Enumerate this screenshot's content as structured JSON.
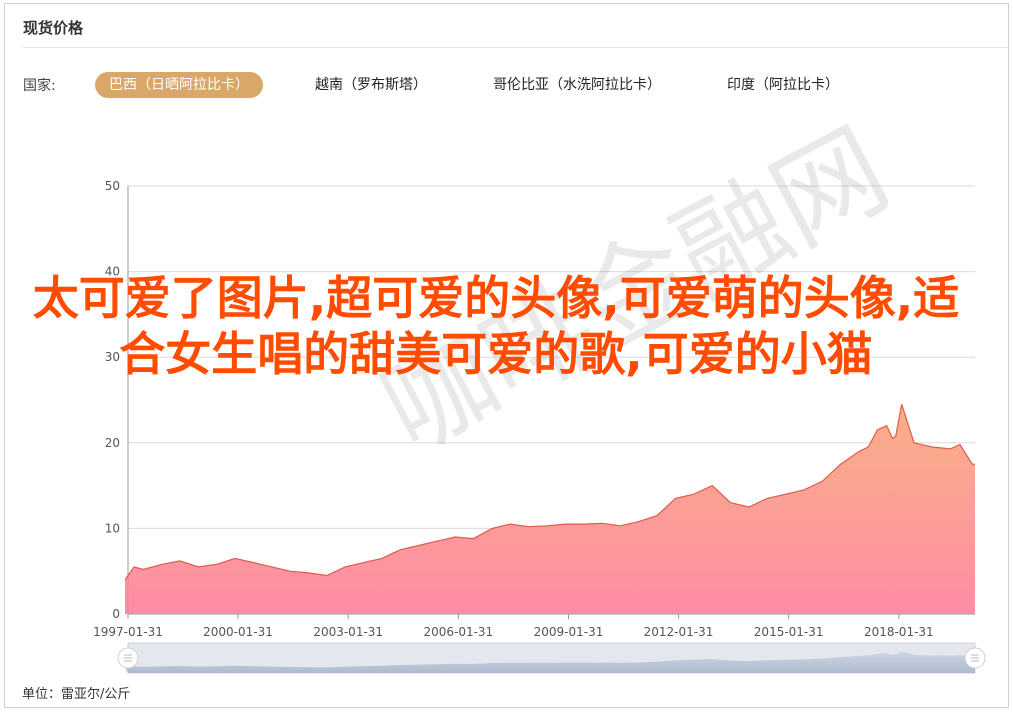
{
  "title": "现货价格",
  "country": {
    "label": "国家:",
    "tabs": [
      "巴西（日晒阿拉比卡）",
      "越南（罗布斯塔）",
      "哥伦比亚（水洗阿拉比卡）",
      "印度（阿拉比卡）"
    ],
    "active_index": 0
  },
  "overlay_text": "太可爱了图片,超可爱的头像,可爱萌的头像,适合女生唱的甜美可爱的歌,可爱的小猫",
  "watermark": "咖啡金融网",
  "unit": "单位：雷亚尔/公斤",
  "colors": {
    "accent": "#d9a868",
    "area_top": "#f7a87a",
    "area_bottom": "#ff7f9c",
    "line": "#e05a4a",
    "overlay": "#ff4c00"
  },
  "chart_data": {
    "type": "area",
    "ylim": [
      0,
      50
    ],
    "yticks": [
      "0",
      "10",
      "20",
      "30",
      "40",
      "50"
    ],
    "xticks": [
      "1997-01-31",
      "2000-01-31",
      "2003-01-31",
      "2006-01-31",
      "2009-01-31",
      "2012-01-31",
      "2015-01-31",
      "2018-01-31"
    ],
    "x_start": "1997-01-31",
    "x_end": "2020-02-28",
    "series": [
      {
        "x": [
          "1997-01",
          "1997-04",
          "1997-07",
          "1998-01",
          "1998-07",
          "1999-01",
          "1999-07",
          "2000-01",
          "2000-07",
          "2001-01",
          "2001-07",
          "2002-01",
          "2002-07",
          "2003-01",
          "2003-07",
          "2004-01",
          "2004-07",
          "2005-01",
          "2005-07",
          "2006-01",
          "2006-07",
          "2007-01",
          "2007-07",
          "2008-01",
          "2008-07",
          "2009-01",
          "2009-07",
          "2010-01",
          "2010-07",
          "2011-01",
          "2011-07",
          "2012-01",
          "2012-07",
          "2013-01",
          "2013-07",
          "2014-01",
          "2014-07",
          "2015-01",
          "2015-07",
          "2016-01",
          "2016-07",
          "2017-01",
          "2017-04",
          "2017-07",
          "2017-10",
          "2017-12",
          "2018-01",
          "2018-03",
          "2018-07",
          "2019-01",
          "2019-07",
          "2019-10",
          "2020-02"
        ],
        "y": [
          4,
          5.5,
          5.2,
          5.8,
          6.2,
          5.5,
          5.8,
          6.5,
          6.0,
          5.5,
          5.0,
          4.8,
          4.5,
          5.5,
          6.0,
          6.5,
          7.5,
          8.0,
          8.5,
          9.0,
          8.8,
          10.0,
          10.5,
          10.2,
          10.3,
          10.5,
          10.5,
          10.6,
          10.3,
          10.8,
          11.5,
          13.5,
          14.0,
          15.0,
          13.0,
          12.5,
          13.5,
          14.0,
          14.5,
          15.5,
          17.5,
          19.0,
          19.5,
          21.5,
          22.0,
          20.5,
          20.8,
          24.5,
          20.0,
          19.5,
          19.3,
          19.8,
          17.5
        ]
      }
    ]
  }
}
